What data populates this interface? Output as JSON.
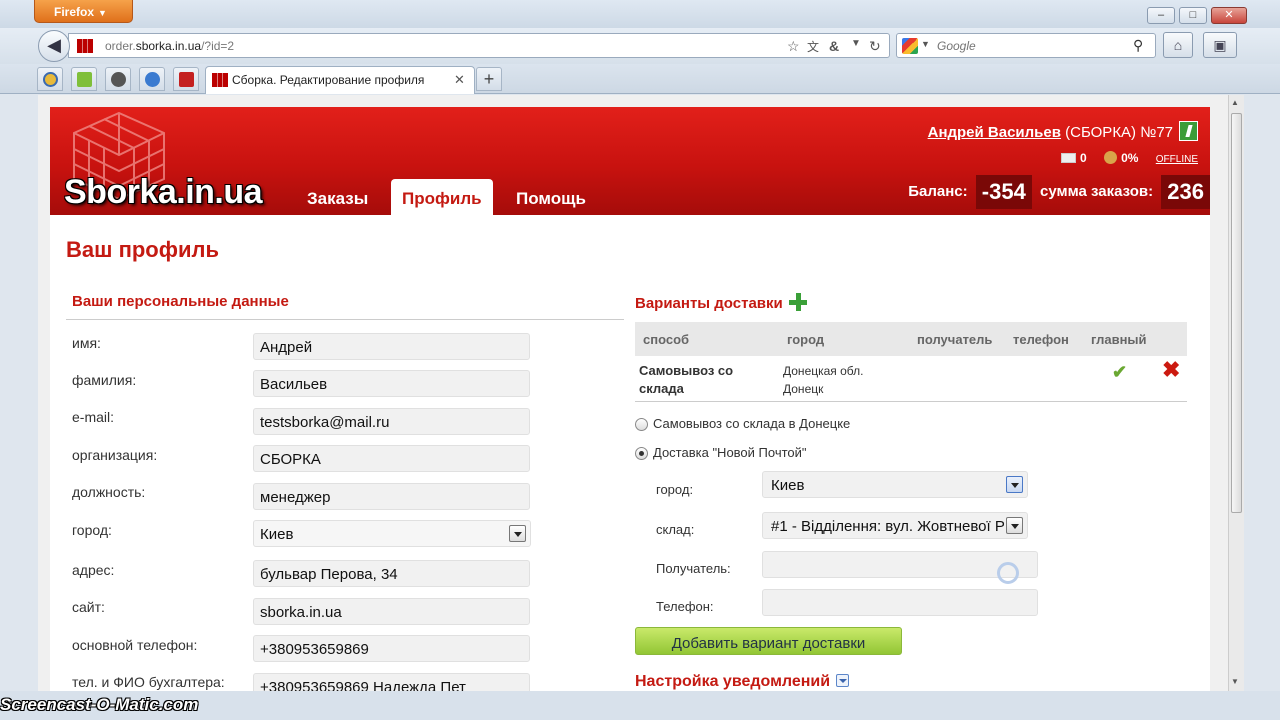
{
  "browser": {
    "app_menu": "Firefox",
    "url_domain": "order.sborka.in.ua",
    "url_prefix": "order.",
    "url_host": "sborka.in.ua",
    "url_path": "/?id=2",
    "search_placeholder": "Google",
    "active_tab_title": "Сборка. Редактирование профиля",
    "window_buttons": [
      "–",
      "□",
      "✕"
    ],
    "new_tab": "+"
  },
  "site": {
    "logo": "Sborka.in.ua",
    "nav": [
      "Заказы",
      "Профиль",
      "Помощь"
    ],
    "user_name": "Андрей Васильев",
    "user_org": "(СБОРКА) №77",
    "messages_count": "0",
    "percent": "0%",
    "offline": "OFFLINE",
    "balance_label": "Баланс:",
    "balance_value": "-354",
    "orders_sum_label": "сумма заказов:",
    "orders_sum_value": "236"
  },
  "page": {
    "title": "Ваш профиль",
    "personal_section": "Ваши персональные данные",
    "delivery_section": "Варианты доставки",
    "notifications_section": "Настройка уведомлений"
  },
  "personal_fields": [
    {
      "label": "имя:",
      "value": "Андрей"
    },
    {
      "label": "фамилия:",
      "value": "Васильев"
    },
    {
      "label": "e-mail:",
      "value": "testsborka@mail.ru"
    },
    {
      "label": "организация:",
      "value": "СБОРКА"
    },
    {
      "label": "должность:",
      "value": "менеджер"
    },
    {
      "label": "город:",
      "value": "Киев"
    },
    {
      "label": "адрес:",
      "value": "бульвар Перова, 34"
    },
    {
      "label": "сайт:",
      "value": "sborka.in.ua"
    },
    {
      "label": "основной телефон:",
      "value": "+380953659869"
    },
    {
      "label": "тел. и ФИО бухгалтера:",
      "value": "+380953659869 Надежда Пет"
    }
  ],
  "delivery_table": {
    "headers": [
      "способ",
      "город",
      "получатель",
      "телефон",
      "главный"
    ],
    "row": {
      "method": "Самовывоз со склада",
      "city_line1": "Донецкая обл.",
      "city_line2": "Донецк"
    }
  },
  "delivery_options": {
    "option1": "Самовывоз со склада в Донецке",
    "option2": "Доставка \"Новой Почтой\"",
    "city_label": "город:",
    "city_value": "Киев",
    "warehouse_label": "склад:",
    "warehouse_value": "#1 - Відділення: вул. Жовтневої Р",
    "recipient_label": "Получатель:",
    "phone_label": "Телефон:",
    "add_button": "Добавить вариант доставки"
  },
  "watermark": "Screencast-O-Matic.com"
}
